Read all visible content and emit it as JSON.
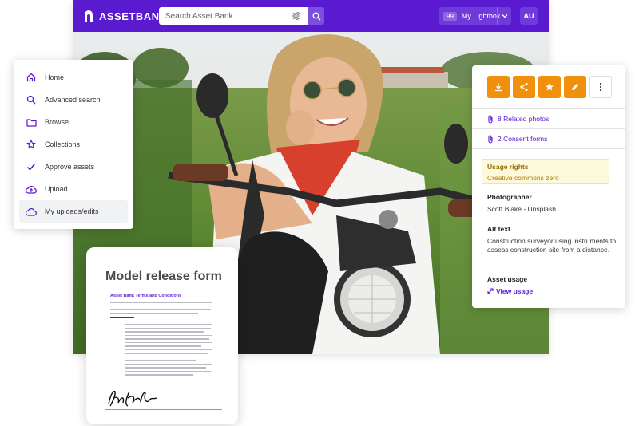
{
  "app": {
    "brand": "ASSETBANK",
    "search": {
      "placeholder": "Search Asset Bank..."
    },
    "lightbox": {
      "count": "99",
      "label": "My Lightbox"
    },
    "user_initials": "AU"
  },
  "sidebar": {
    "items": [
      {
        "label": "Home",
        "icon": "home-icon"
      },
      {
        "label": "Advanced search",
        "icon": "search-icon"
      },
      {
        "label": "Browse",
        "icon": "folder-icon"
      },
      {
        "label": "Collections",
        "icon": "star-icon"
      },
      {
        "label": "Approve assets",
        "icon": "check-icon"
      },
      {
        "label": "Upload",
        "icon": "cloud-upload-icon"
      },
      {
        "label": "My uploads/edits",
        "icon": "cloud-icon",
        "active": true
      }
    ]
  },
  "release_form": {
    "title": "Model release form",
    "doc_heading": "Asset Bank Terms and Conditions"
  },
  "details": {
    "actions": [
      "download-icon",
      "share-icon",
      "star-icon",
      "edit-icon",
      "more-icon"
    ],
    "related_photos": "8 Related photos",
    "consent_forms": "2 Consent forms",
    "usage_rights": {
      "label": "Usage rights",
      "value": "Creative commons zero"
    },
    "photographer": {
      "label": "Photographer",
      "value": "Scott Blake - Unsplash"
    },
    "alt_text": {
      "label": "Alt text",
      "value": "Construction surveyor using instruments to assess construction site from a distance."
    },
    "asset_usage": {
      "label": "Asset usage",
      "link": "View usage"
    }
  },
  "colors": {
    "brand": "#5a1ad0",
    "accent_orange": "#f0900c",
    "usage_highlight": "#fdf9dc"
  }
}
